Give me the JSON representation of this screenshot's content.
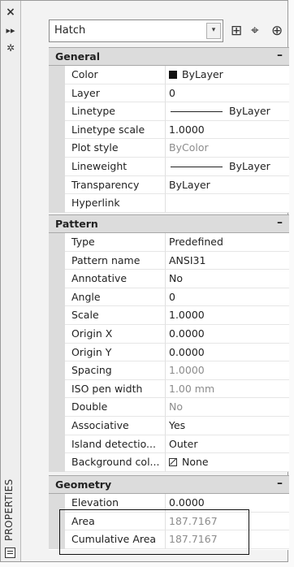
{
  "panel": {
    "vertical_title": "PROPERTIES",
    "object_type": "Hatch"
  },
  "sections": {
    "general": {
      "title": "General",
      "toggle": "–",
      "rows": [
        {
          "name": "Color",
          "value": "ByLayer"
        },
        {
          "name": "Layer",
          "value": "0"
        },
        {
          "name": "Linetype",
          "value": "ByLayer"
        },
        {
          "name": "Linetype scale",
          "value": "1.0000"
        },
        {
          "name": "Plot style",
          "value": "ByColor"
        },
        {
          "name": "Lineweight",
          "value": "ByLayer"
        },
        {
          "name": "Transparency",
          "value": "ByLayer"
        },
        {
          "name": "Hyperlink",
          "value": ""
        }
      ]
    },
    "pattern": {
      "title": "Pattern",
      "toggle": "–",
      "rows": [
        {
          "name": "Type",
          "value": "Predefined"
        },
        {
          "name": "Pattern name",
          "value": "ANSI31"
        },
        {
          "name": "Annotative",
          "value": "No"
        },
        {
          "name": "Angle",
          "value": "0"
        },
        {
          "name": "Scale",
          "value": "1.0000"
        },
        {
          "name": "Origin X",
          "value": "0.0000"
        },
        {
          "name": "Origin Y",
          "value": "0.0000"
        },
        {
          "name": "Spacing",
          "value": "1.0000"
        },
        {
          "name": "ISO pen width",
          "value": "1.00 mm"
        },
        {
          "name": "Double",
          "value": "No"
        },
        {
          "name": "Associative",
          "value": "Yes"
        },
        {
          "name": "Island detectio...",
          "value": "Outer"
        },
        {
          "name": "Background col...",
          "value": "None"
        }
      ]
    },
    "geometry": {
      "title": "Geometry",
      "toggle": "–",
      "rows": [
        {
          "name": "Elevation",
          "value": "0.0000"
        },
        {
          "name": "Area",
          "value": "187.7167"
        },
        {
          "name": "Cumulative Area",
          "value": "187.7167"
        }
      ]
    }
  },
  "icons": {
    "close": "×",
    "pin": "▸▸",
    "settings": "✲",
    "dropdown": "▾",
    "quick_select": "⊞",
    "pick_objects": "⌖",
    "toggle_pickadd": "⊕"
  }
}
